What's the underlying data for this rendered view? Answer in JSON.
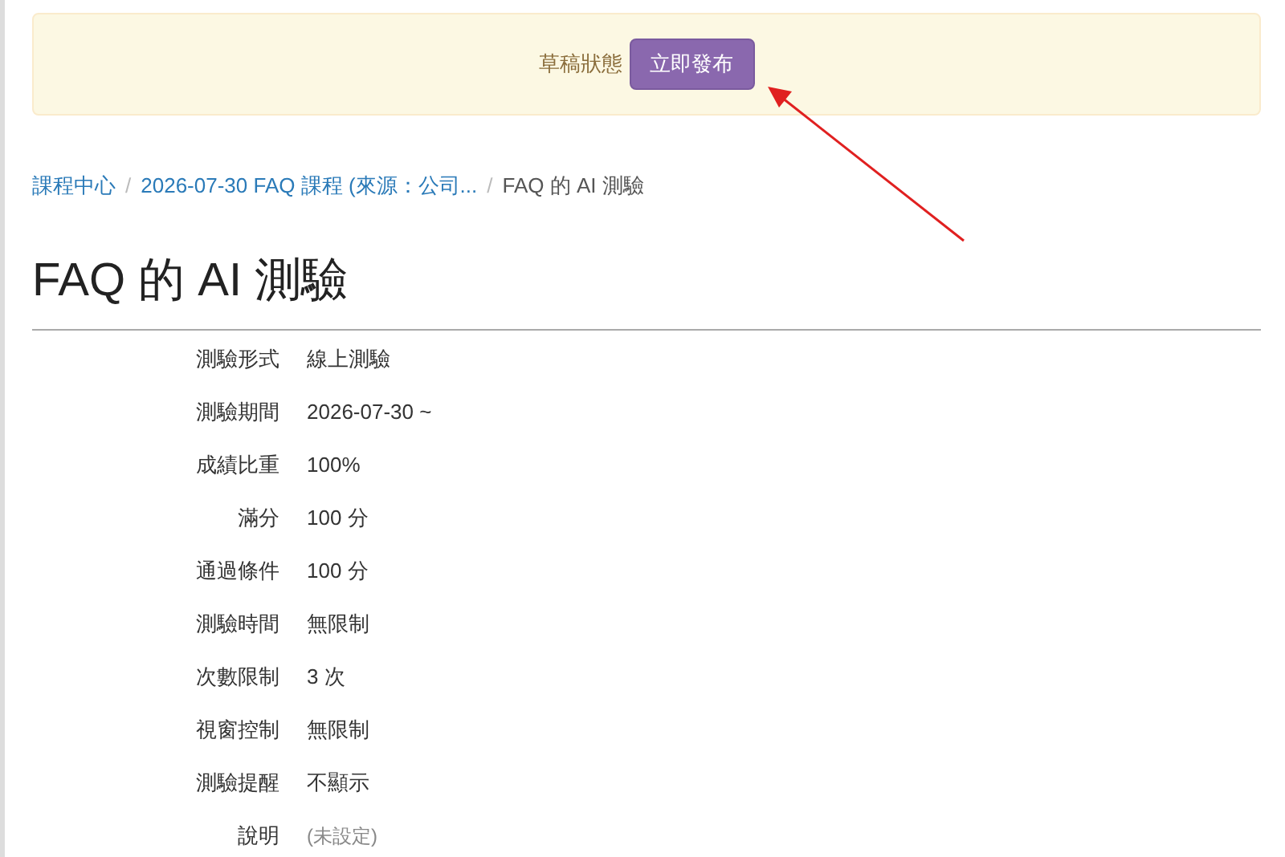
{
  "banner": {
    "status": "草稿狀態",
    "button": "立即發布"
  },
  "breadcrumb_separator": "/",
  "breadcrumb": [
    {
      "label": "課程中心",
      "link": true
    },
    {
      "label": "2026-07-30 FAQ 課程 (來源：公司...",
      "link": true
    },
    {
      "label": "FAQ 的 AI 測驗",
      "link": false
    }
  ],
  "title": "FAQ 的 AI 測驗",
  "details": [
    {
      "label": "測驗形式",
      "value": "線上測驗",
      "muted": false
    },
    {
      "label": "測驗期間",
      "value": "2026-07-30 ~",
      "muted": false
    },
    {
      "label": "成績比重",
      "value": "100%",
      "muted": false
    },
    {
      "label": "滿分",
      "value": "100 分",
      "muted": false
    },
    {
      "label": "通過條件",
      "value": "100 分",
      "muted": false
    },
    {
      "label": "測驗時間",
      "value": "無限制",
      "muted": false
    },
    {
      "label": "次數限制",
      "value": "3 次",
      "muted": false
    },
    {
      "label": "視窗控制",
      "value": "無限制",
      "muted": false
    },
    {
      "label": "測驗提醒",
      "value": "不顯示",
      "muted": false
    },
    {
      "label": "說明",
      "value": "(未設定)",
      "muted": true
    }
  ]
}
